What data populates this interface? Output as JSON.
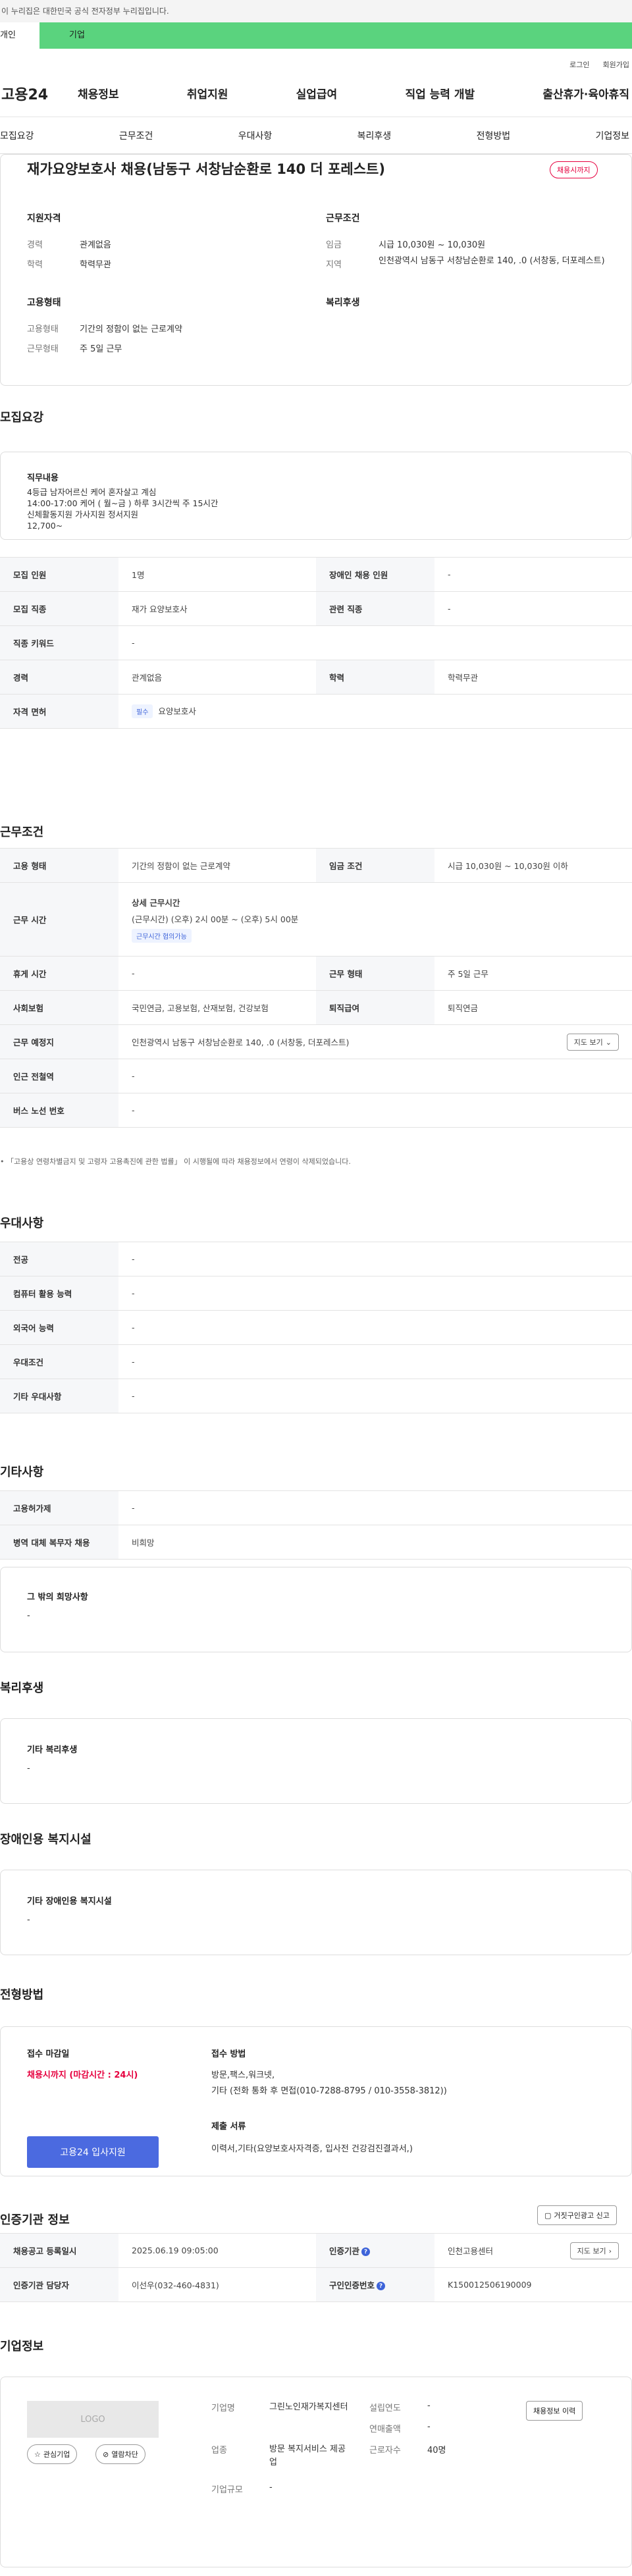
{
  "topbar": {
    "notice": "이 누리집은 대한민국 공식 전자정부 누리집입니다."
  },
  "tabs": {
    "personal": "개인",
    "company": "기업"
  },
  "util": {
    "login": "로그인",
    "join": "회원가입"
  },
  "gnb": {
    "logo": "고용24",
    "menu": [
      "채용정보",
      "취업지원",
      "실업급여",
      "직업 능력 개발",
      "출산휴가·육아휴직"
    ]
  },
  "subtabs": [
    "모집요강",
    "근무조건",
    "우대사항",
    "복리후생",
    "전형방법",
    "기업정보"
  ],
  "head": {
    "title": "재가요양보호사 채용(남동구 서창남순환로 140 더 포레스트)",
    "badge": "채용시까지",
    "qual_title": "지원자격",
    "exp_label": "경력",
    "exp_val": "관계없음",
    "edu_label": "학력",
    "edu_val": "학력무관",
    "cond_title": "근무조건",
    "wage_label": "임금",
    "wage_val": "시급 10,030원 ~ 10,030원",
    "region_label": "지역",
    "region_val": "인천광역시 남동구 서창남순환로 140, .0 (서창동, 더포레스트)",
    "emp_title": "고용형태",
    "type_label": "고용형태",
    "type_val": "기간의 정함이 없는 근로계약",
    "work_label": "근무형태",
    "work_val": "주 5일 근무",
    "welfare_title": "복리후생"
  },
  "recruit": {
    "title": "모집요강",
    "duty_title": "직무내용",
    "duty_lines": [
      "4등급  남자어르신 케어 혼자살고 계심",
      "14:00-17:00 케어 ( 월~금 )  하루 3시간씩  주 15시간",
      "신체활동지원 가사지원 정서지원",
      "12,700~"
    ],
    "headcount_l": "모집 인원",
    "headcount_v": "1명",
    "disabled_l": "장애인 채용 인원",
    "disabled_v": "-",
    "job_l": "모집 직종",
    "job_v": "재가 요양보호사",
    "rel_l": "관련 직종",
    "rel_v": "-",
    "kw_l": "직종 키워드",
    "kw_v": "-",
    "career_l": "경력",
    "career_v": "관계없음",
    "edu_l": "학력",
    "edu_v": "학력무관",
    "license_l": "자격 면허",
    "license_chip": "필수",
    "license_v": "요양보호사"
  },
  "work": {
    "title": "근무조건",
    "type_l": "고용 형태",
    "type_v": "기간의 정함이 없는 근로계약",
    "wage_l": "임금 조건",
    "wage_v": "시급 10,030원 ~ 10,030원 이하",
    "hours_l": "근무 시간",
    "hours_title": "상세 근무시간",
    "hours_v": "(근무시간) (오후) 2시 00분 ~ (오후) 5시 00분",
    "hours_chip": "근무시간 협의가능",
    "rest_l": "휴게 시간",
    "rest_v": "-",
    "form_l": "근무 형태",
    "form_v": "주 5일 근무",
    "ins_l": "사회보험",
    "ins_v": "국민연금, 고용보험, 산재보험, 건강보험",
    "sev_l": "퇴직급여",
    "sev_v": "퇴직연금",
    "place_l": "근무 예정지",
    "place_v": "인천광역시 남동구 서창남순환로 140, .0 (서창동, 더포레스트)",
    "map_btn": "지도 보기",
    "subway_l": "인근 전철역",
    "subway_v": "-",
    "bus_l": "버스 노선 번호",
    "bus_v": "-",
    "note": "「고용상 연령차별금지 및 고령자 고용촉진에 관한 법률」 이 시행될에 따라 채용정보에서 연령이 삭제되었습니다."
  },
  "pref": {
    "title": "우대사항",
    "rows": [
      {
        "l": "전공",
        "v": "-"
      },
      {
        "l": "컴퓨터 활용 능력",
        "v": "-"
      },
      {
        "l": "외국어 능력",
        "v": "-"
      },
      {
        "l": "우대조건",
        "v": "-"
      },
      {
        "l": "기타 우대사항",
        "v": "-"
      }
    ]
  },
  "etc": {
    "title": "기타사항",
    "rows": [
      {
        "l": "고용허가제",
        "v": "-"
      },
      {
        "l": "병역 대체 복무자 채용",
        "v": "비희망"
      }
    ],
    "other_title": "그 밖의 희망사항",
    "other_v": "-"
  },
  "welfare": {
    "title": "복리후생",
    "box_title": "기타 복리후생",
    "box_v": "-"
  },
  "disfac": {
    "title": "장애인용 복지시설",
    "box_title": "기타 장애인용 복지시설",
    "box_v": "-"
  },
  "select": {
    "title": "전형방법",
    "deadline_t": "접수 마감일",
    "deadline_v": "채용시까지 (마감시간 : 24시)",
    "apply_btn": "고용24 입사지원",
    "method_t": "접수 방법",
    "method_v1": "방문,팩스,워크넷,",
    "method_v2": "기타 (전화 통화 후 면접(010-7288-8795 / 010-3558-3812))",
    "docs_t": "제출 서류",
    "docs_v": "이력서,기타(요양보호사자격증, 입사전 건강검진결과서,)"
  },
  "agency": {
    "title": "인증기관 정보",
    "report_btn": "거짓구인광고 신고",
    "reg_l": "채용공고 등록일시",
    "reg_v": "2025.06.19 09:05:00",
    "org_l": "인증기관",
    "org_v": "인천고용센터",
    "map_btn": "지도 보기",
    "mgr_l": "인증기관 담당자",
    "mgr_v": "이선우(032-460-4831)",
    "no_l": "구인인증번호",
    "no_v": "K150012506190009"
  },
  "company": {
    "title": "기업정보",
    "logo": "LOGO",
    "fav_btn": "관심기업",
    "block_btn": "열람차단",
    "name_l": "기업명",
    "name_v": "그린노인재가복지센터",
    "ind_l": "업종",
    "ind_v": "방문 복지서비스 제공업",
    "size_l": "기업규모",
    "size_v": "-",
    "year_l": "설립연도",
    "year_v": "-",
    "sales_l": "연매출액",
    "sales_v": "-",
    "emp_l": "근로자수",
    "emp_v": "40명",
    "history_btn": "채용정보 이력"
  }
}
